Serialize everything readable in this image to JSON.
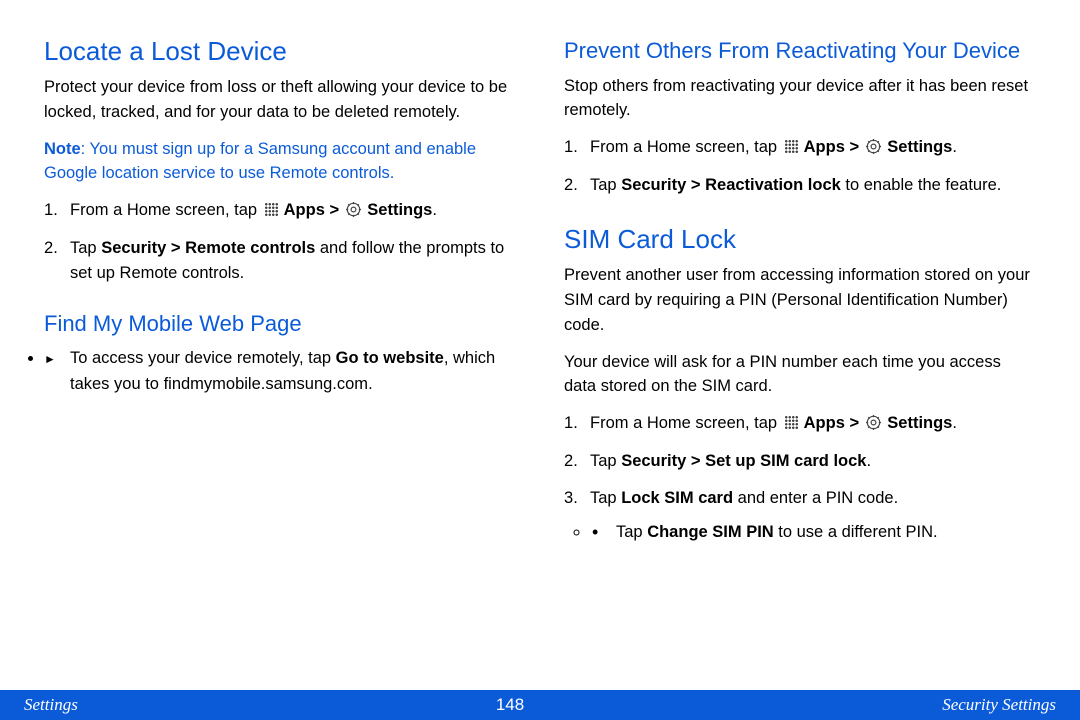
{
  "left": {
    "h1": "Locate a Lost Device",
    "p1": "Protect your device from loss or theft allowing your device to be locked, tracked, and for your data to be deleted remotely.",
    "noteLabel": "Note",
    "noteBody": ": You must sign up for a Samsung account and enable Google location service to use Remote controls.",
    "step1a": "From a Home screen, tap ",
    "step1b": " Apps > ",
    "step1c": " Settings",
    "step1d": ".",
    "step2a": "Tap ",
    "step2b": "Security > Remote controls",
    "step2c": " and follow the prompts to set up Remote controls.",
    "h2": "Find My Mobile Web Page",
    "arrow_a": "To access your device remotely, tap ",
    "arrow_b": "Go to website",
    "arrow_c": ", which takes you to ",
    "arrow_d": "findmymobile.samsung.com",
    "arrow_e": "."
  },
  "right": {
    "h2a": "Prevent Others From Reactivating Your Device",
    "p1": "Stop others from reactivating your device after it has been reset remotely.",
    "s1a": "From a Home screen, tap ",
    "s1b": " Apps > ",
    "s1c": " Settings",
    "s1d": ".",
    "s2a": "Tap ",
    "s2b": "Security > Reactivation lock",
    "s2c": " to enable the feature.",
    "h1b": "SIM Card Lock",
    "p2": "Prevent another user from accessing information stored on your SIM card by requiring a PIN (Personal Identification Number) code.",
    "p3": "Your device will ask for a PIN number each time you access data stored on the SIM card.",
    "t1a": "From a Home screen, tap ",
    "t1b": " Apps > ",
    "t1c": " Settings",
    "t1d": ".",
    "t2a": "Tap ",
    "t2b": "Security > Set up SIM card lock",
    "t2c": ".",
    "t3a": "Tap ",
    "t3b": "Lock SIM card",
    "t3c": " and enter a PIN code.",
    "t3s_a": "Tap ",
    "t3s_b": "Change SIM PIN",
    "t3s_c": " to use a different PIN."
  },
  "footer": {
    "left": "Settings",
    "center": "148",
    "right": "Security Settings"
  }
}
